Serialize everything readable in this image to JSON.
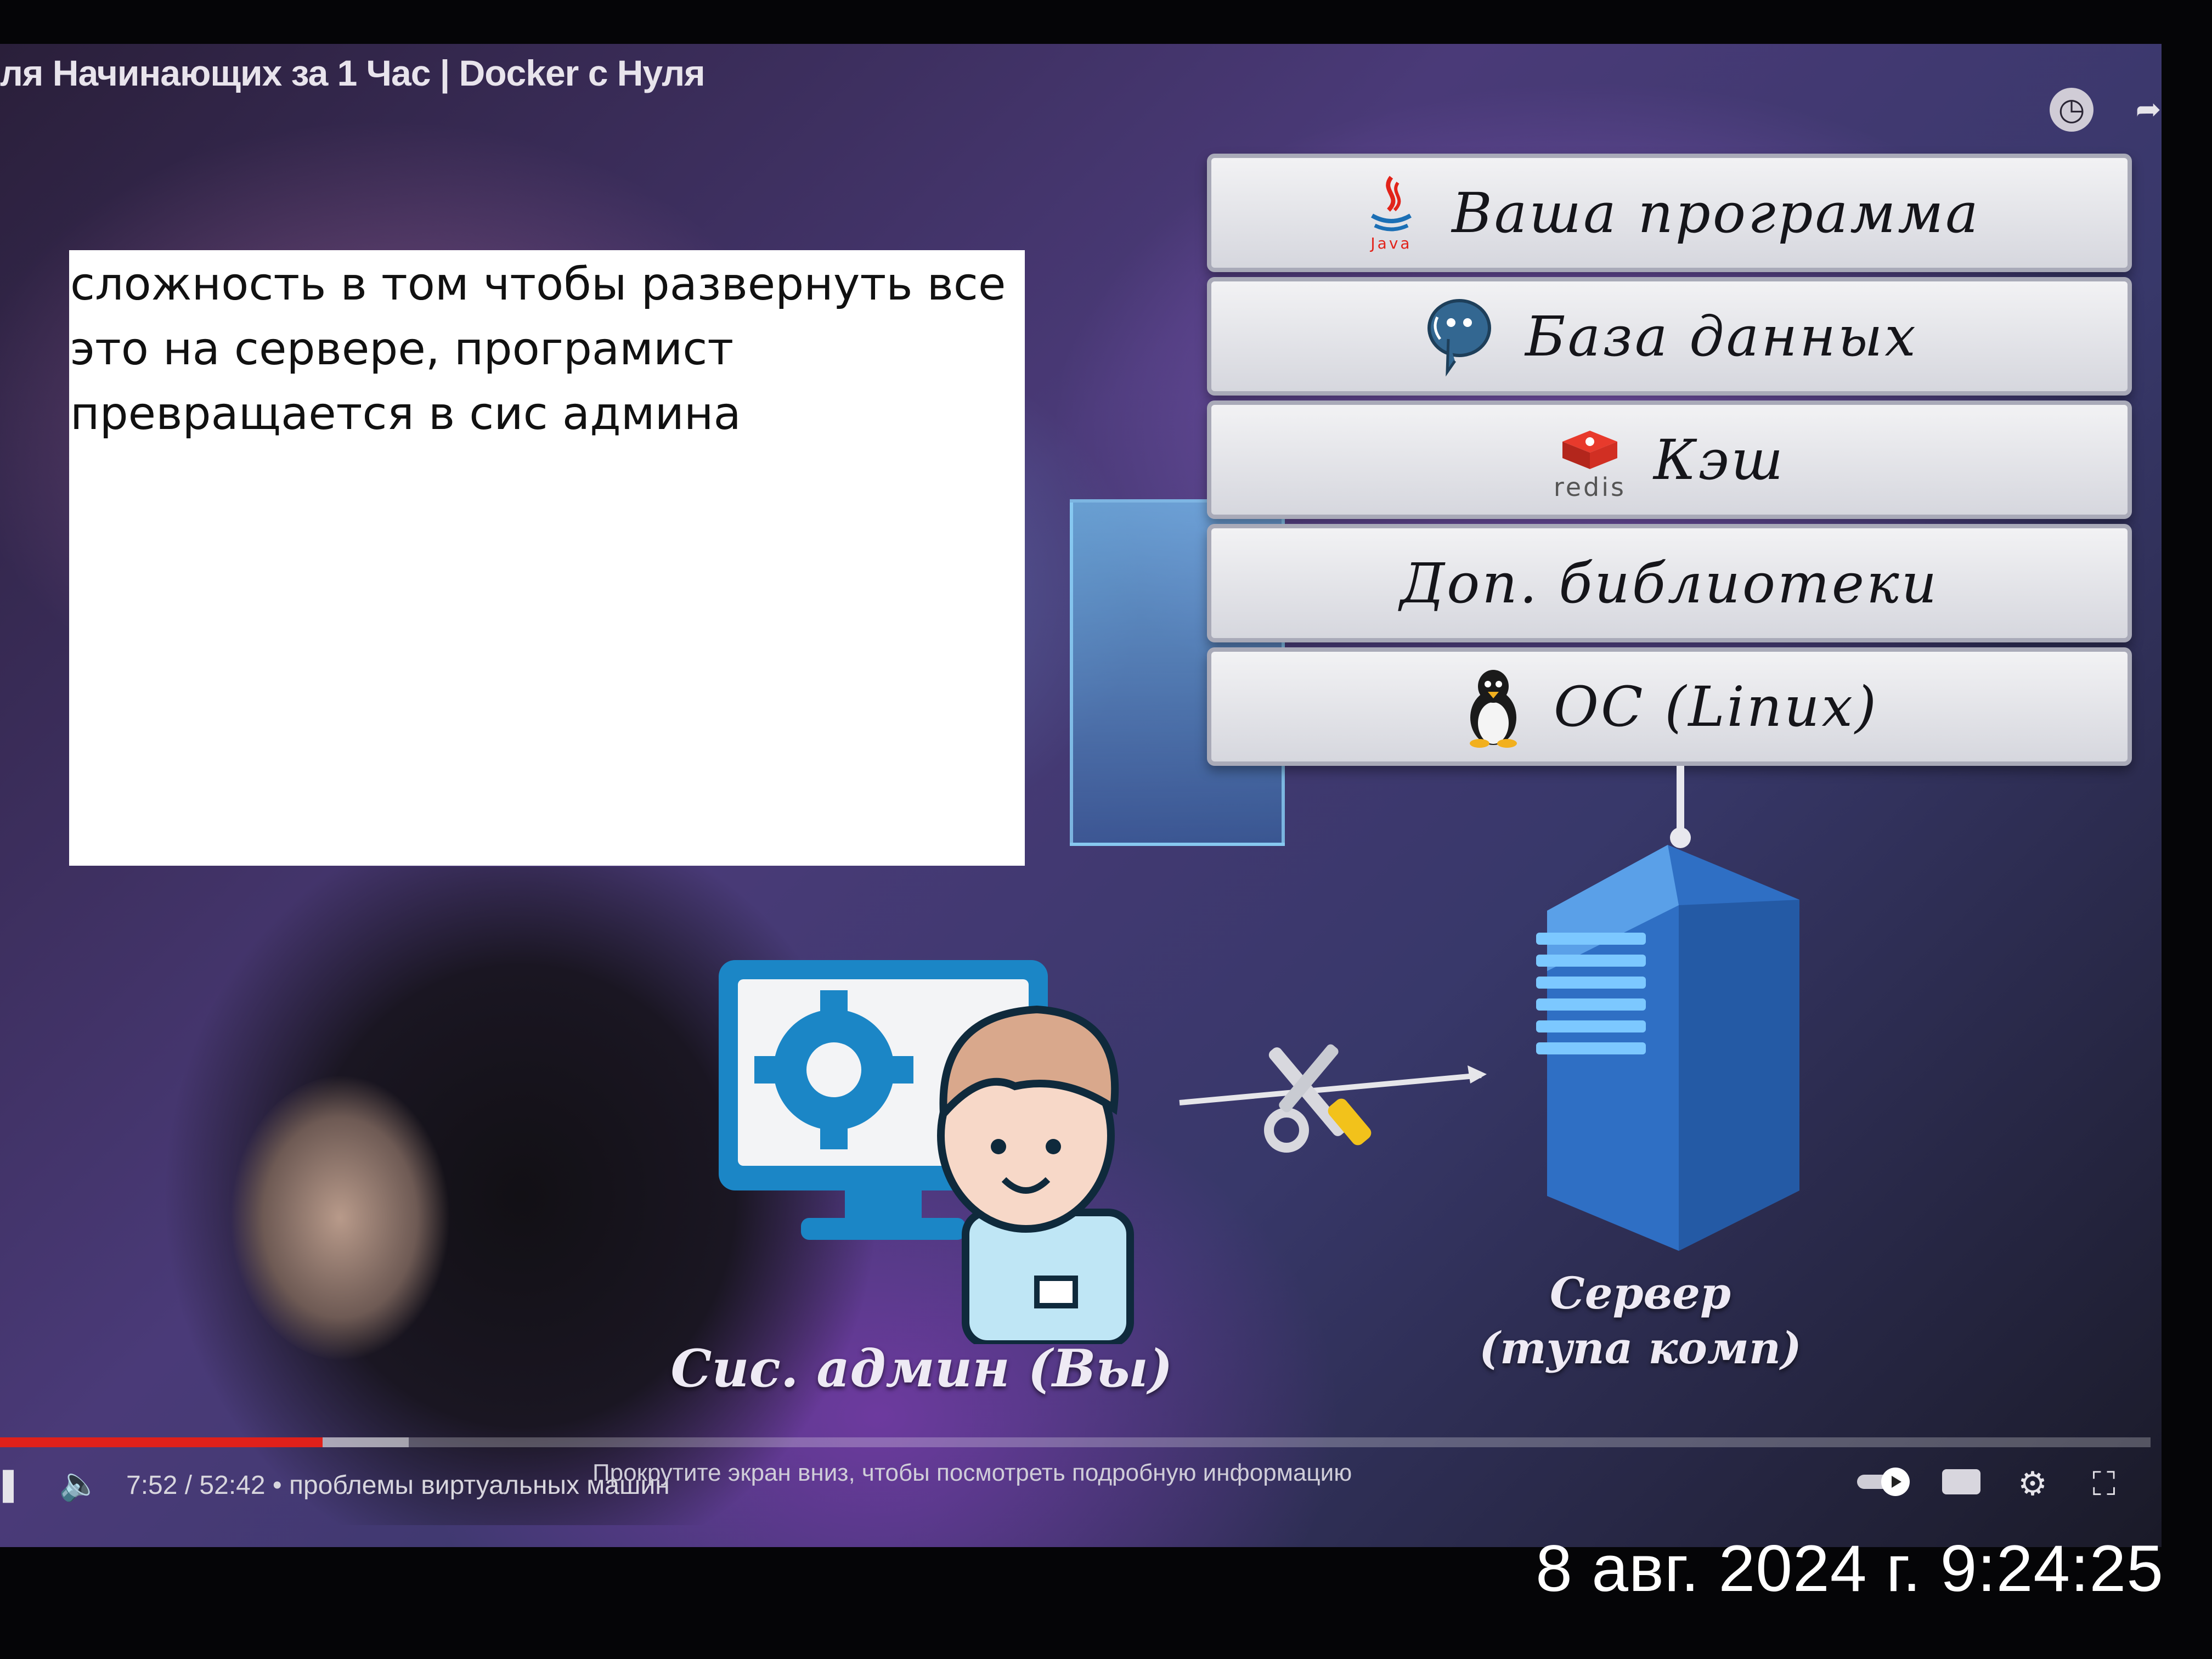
{
  "video": {
    "title": "ля Начинающих за 1 Час | Docker с Нуля",
    "top_icons": [
      "clock-icon",
      "share-icon"
    ]
  },
  "note": {
    "text": "сложность в том чтобы развернуть все это на сервере, програмист превращается в сис админа"
  },
  "slide": {
    "layers": [
      {
        "label": "Ваша программа",
        "icon": "java-icon"
      },
      {
        "label": "База данных",
        "icon": "postgresql-icon"
      },
      {
        "label": "Кэш",
        "icon": "redis-icon",
        "icon_text": "redis"
      },
      {
        "label": "Доп. библиотеки",
        "icon": ""
      },
      {
        "label": "ОС (Linux)",
        "icon": "linux-penguin-icon"
      }
    ],
    "admin_caption": "Сис. админ (Вы)",
    "server_caption_line1": "Сервер",
    "server_caption_line2": "(тупа комп)",
    "colors": {
      "layer_bg": "#e4e5ea",
      "layer_border": "#a9aab8",
      "server_blue": "#2f6fc4",
      "admin_skin": "#f7d8c8",
      "admin_hair": "#d9a88c",
      "monitor_blue": "#1b86c6"
    }
  },
  "player": {
    "time": "7:52 / 52:42",
    "chapter": "• проблемы виртуальных машин",
    "hint": "Прокрутите экран вниз, чтобы посмотреть подробную информацию",
    "progress_fraction": 0.15,
    "buffer_fraction": 0.19,
    "controls": [
      "play-pause-icon",
      "volume-icon",
      "autoplay-toggle-icon",
      "subtitles-icon",
      "settings-gear-icon",
      "fullscreen-icon"
    ]
  },
  "photo_timestamp": "8 авг. 2024 г. 9:24:25"
}
